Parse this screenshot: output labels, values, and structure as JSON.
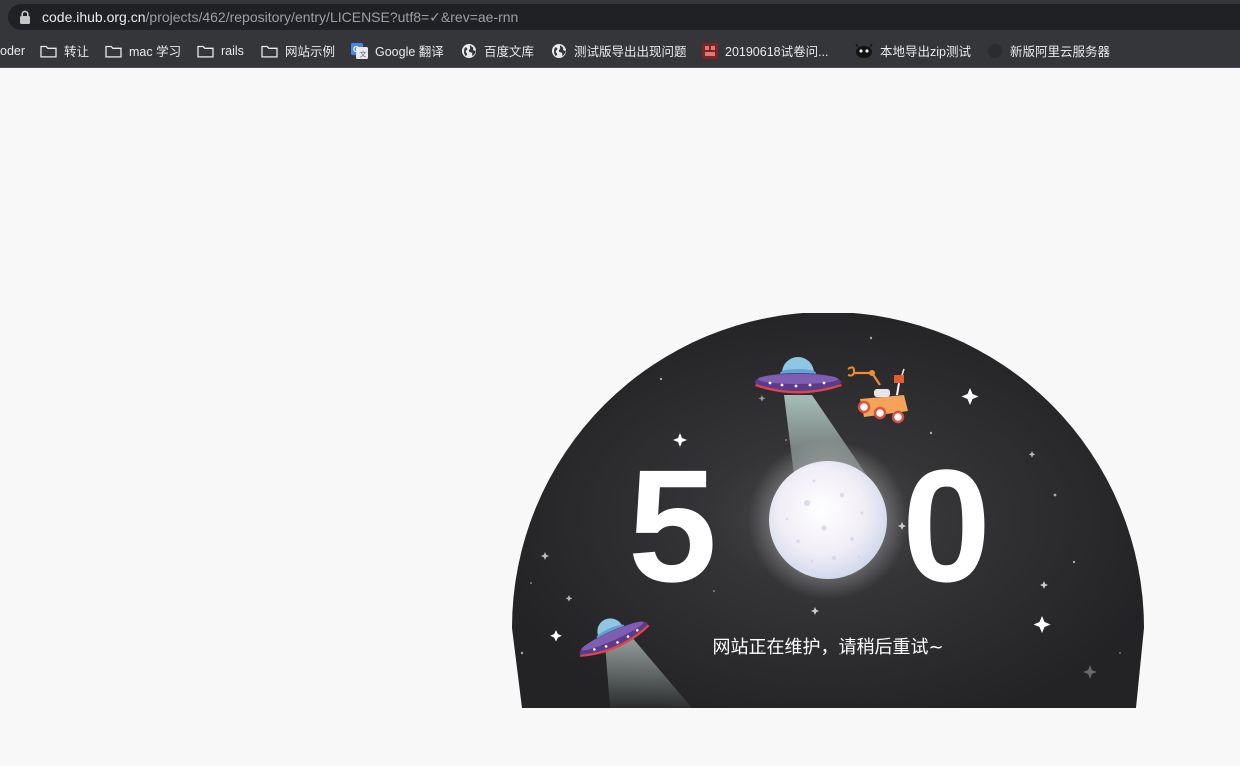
{
  "browser": {
    "url_host": "code.ihub.org.cn",
    "url_path": "/projects/462/repository/entry/LICENSE?utf8=✓&rev=ae-rnn",
    "bookmarks": [
      {
        "label": "oder",
        "icon": "none"
      },
      {
        "label": "转让",
        "icon": "folder-icon"
      },
      {
        "label": "mac 学习",
        "icon": "folder-icon"
      },
      {
        "label": "rails",
        "icon": "folder-icon"
      },
      {
        "label": "网站示例",
        "icon": "folder-icon"
      },
      {
        "label": "Google 翻译",
        "icon": "google-translate-icon"
      },
      {
        "label": "百度文库",
        "icon": "globe-icon"
      },
      {
        "label": "测试版导出出现问题",
        "icon": "globe-icon"
      },
      {
        "label": "20190618试卷问...",
        "icon": "site-favicon"
      },
      {
        "label": "本地导出zip测试",
        "icon": "alien-favicon"
      },
      {
        "label": "新版阿里云服务器",
        "icon": "dark-circle-icon"
      }
    ]
  },
  "error": {
    "code_first": "5",
    "code_last": "0",
    "message": "网站正在维护，请稍后重试~"
  },
  "colors": {
    "chrome_bg": "#35363a",
    "omnibox_bg": "#202124",
    "page_bg": "#f8f8f8",
    "dome_bg": "#2a2a2c",
    "ufo_purple": "#5b3b8c",
    "ufo_red": "#e0434a"
  }
}
